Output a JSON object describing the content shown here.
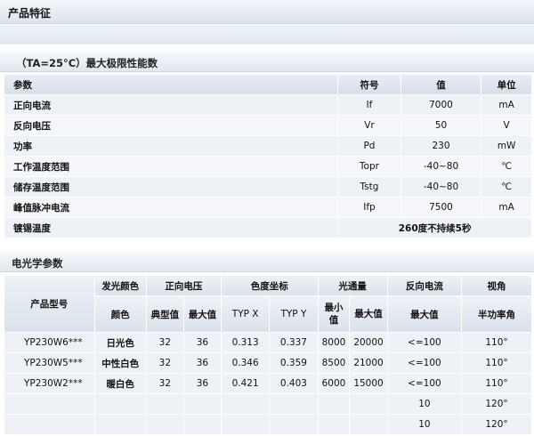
{
  "page_title": "产品特征",
  "section1": {
    "title": "（TA=25°C）最大极限性能数",
    "headers": [
      "参数",
      "符号",
      "值",
      "单位"
    ],
    "rows": [
      [
        "正向电流",
        "If",
        "7000",
        "mA"
      ],
      [
        "反向电压",
        "Vr",
        "50",
        "V"
      ],
      [
        "功率",
        "Pd",
        "230",
        "mW"
      ],
      [
        "工作温度范围",
        "Topr",
        "-40~80",
        "℃"
      ],
      [
        "储存温度范围",
        "Tstg",
        "-40~80",
        "℃"
      ],
      [
        "峰值脉冲电流",
        "Ifp",
        "7500",
        "mA"
      ]
    ],
    "solder": {
      "label": "镀锡温度",
      "value": "260度不持续5秒"
    }
  },
  "section2": {
    "title": "电光学参数",
    "head": {
      "model": "产品型号",
      "color_group": "发光颜色",
      "color": "颜色",
      "vf": "正向电压",
      "vf_typ": "典型值",
      "vf_max": "最大值",
      "cie": "色度坐标",
      "typx": "TYP X",
      "typy": "TYP Y",
      "flux": "光通量",
      "flux_min": "最小值",
      "flux_max": "最大值",
      "ir": "反向电流",
      "ir_max": "最大值",
      "angle": "视角",
      "angle_sub": "半功率角"
    },
    "rows": [
      {
        "model": "YP230W6***",
        "color": "日光色",
        "vf_typ": "32",
        "vf_max": "36",
        "x": "0.313",
        "y": "0.337",
        "fmin": "8000",
        "fmax": "20000",
        "ir": "<=100",
        "angle": "110°"
      },
      {
        "model": "YP230W5***",
        "color": "中性白色",
        "vf_typ": "32",
        "vf_max": "36",
        "x": "0.346",
        "y": "0.359",
        "fmin": "8500",
        "fmax": "21000",
        "ir": "<=100",
        "angle": "110°"
      },
      {
        "model": "YP230W2***",
        "color": "暖白色",
        "vf_typ": "32",
        "vf_max": "36",
        "x": "0.421",
        "y": "0.403",
        "fmin": "6000",
        "fmax": "15000",
        "ir": "<=100",
        "angle": "110°"
      },
      {
        "ir": "10",
        "angle": "120°"
      },
      {
        "ir": "10",
        "angle": "120°"
      }
    ]
  }
}
